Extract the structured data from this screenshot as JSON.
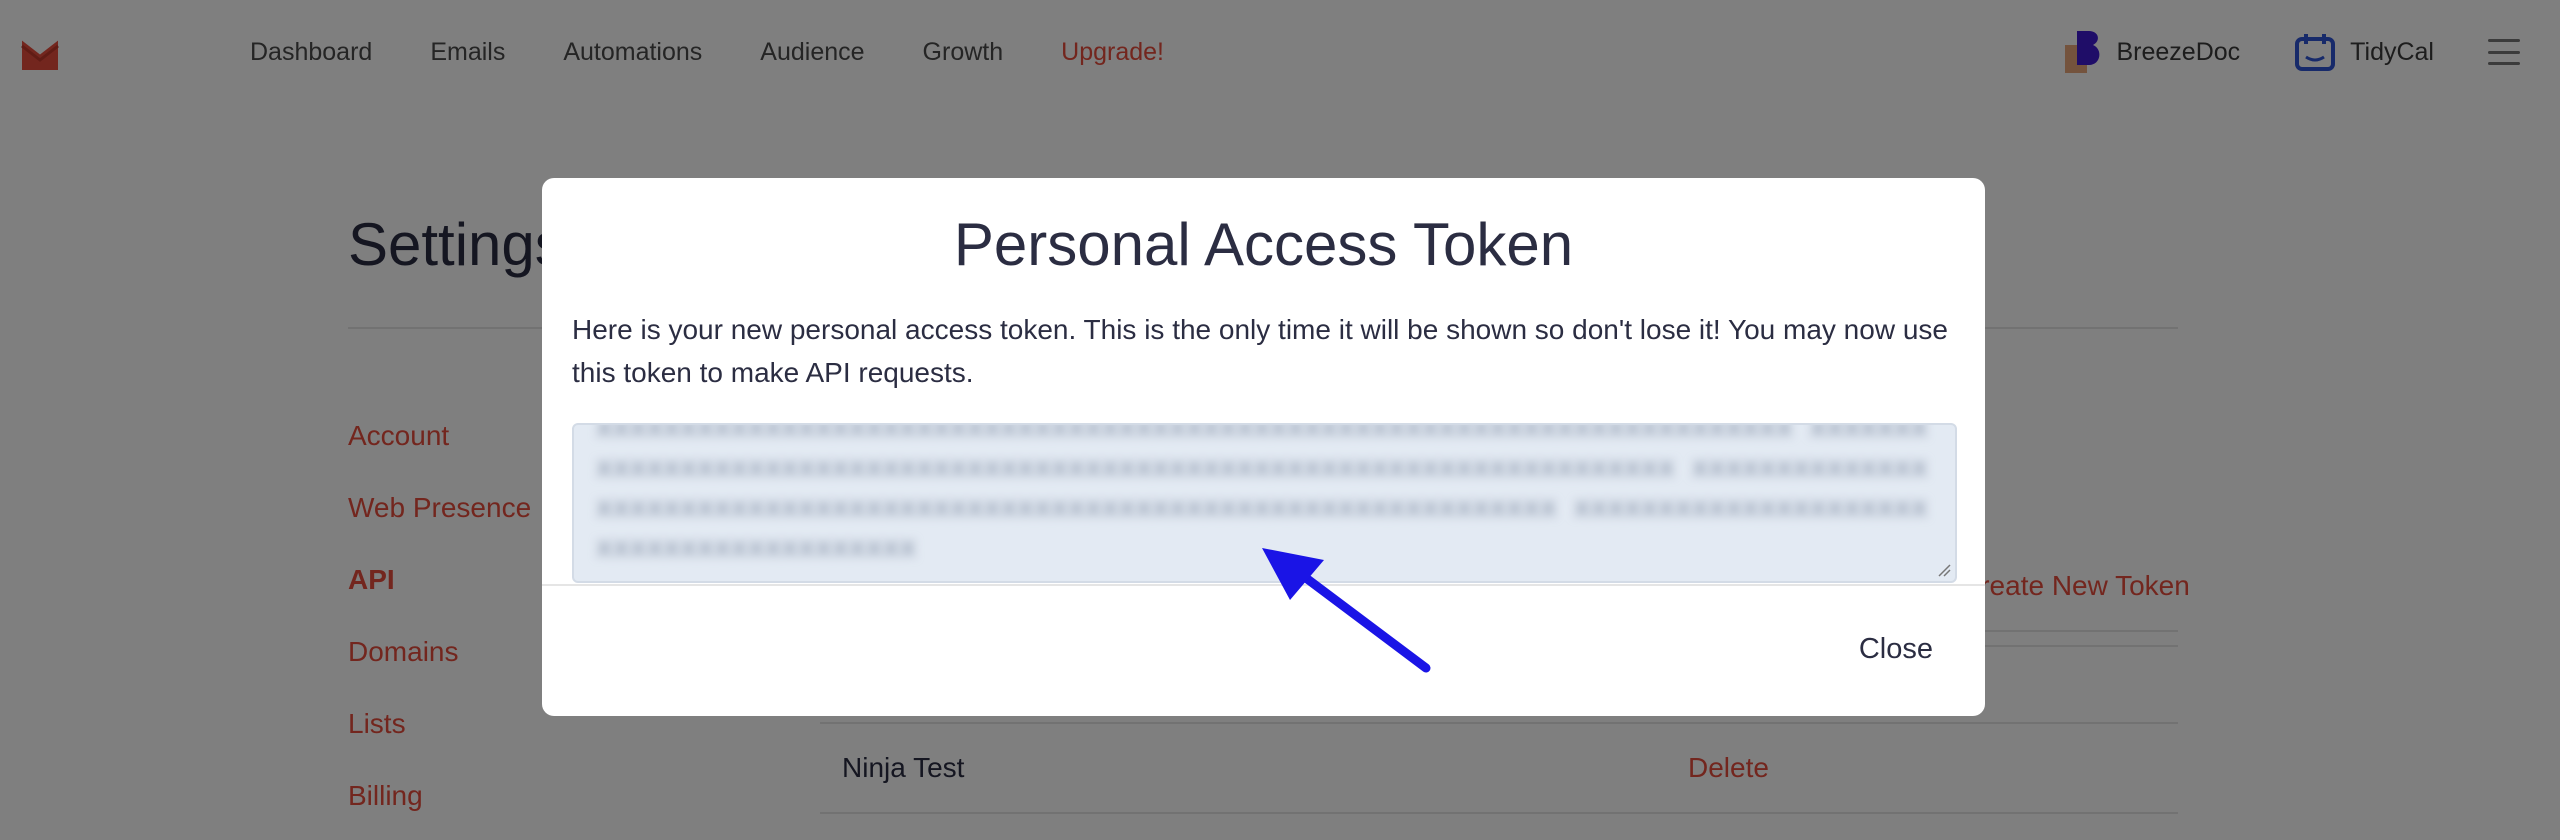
{
  "nav": {
    "items": [
      "Dashboard",
      "Emails",
      "Automations",
      "Audience",
      "Growth"
    ],
    "upgrade": "Upgrade!",
    "brands": [
      {
        "name": "BreezeDoc",
        "icon": "breezedoc-icon"
      },
      {
        "name": "TidyCal",
        "icon": "tidycal-icon"
      }
    ]
  },
  "page": {
    "title": "Settings",
    "sidebar": [
      "Account",
      "Web Presence",
      "API",
      "Domains",
      "Lists",
      "Billing"
    ],
    "active_sidebar": "API",
    "create_token": "Create New Token",
    "tokens": [
      {
        "name": "Ninja Test",
        "action": "Delete"
      }
    ]
  },
  "modal": {
    "title": "Personal Access Token",
    "message": "Here is your new personal access token. This is the only time it will be shown so don't lose it! You may now use this token to make API requests.",
    "close": "Close"
  },
  "colors": {
    "accent": "#e74c3c",
    "overlay": "rgba(0,0,0,0.5)",
    "token_bg": "#e3eaf3",
    "arrow": "#1a14e6"
  }
}
